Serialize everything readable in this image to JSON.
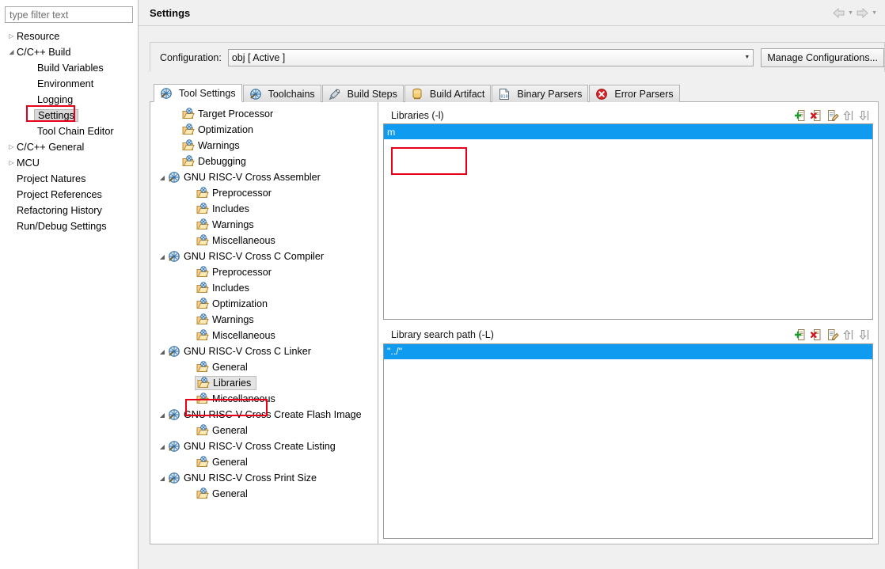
{
  "sidebar": {
    "filter": {
      "placeholder": "type filter text",
      "value": ""
    },
    "items": [
      {
        "label": "Resource",
        "indent": 1,
        "arrow": "collapsed",
        "selected": false
      },
      {
        "label": "C/C++ Build",
        "indent": 1,
        "arrow": "expanded",
        "selected": false
      },
      {
        "label": "Build Variables",
        "indent": 2,
        "arrow": "none",
        "selected": false
      },
      {
        "label": "Environment",
        "indent": 2,
        "arrow": "none",
        "selected": false
      },
      {
        "label": "Logging",
        "indent": 2,
        "arrow": "none",
        "selected": false
      },
      {
        "label": "Settings",
        "indent": 2,
        "arrow": "none",
        "selected": true
      },
      {
        "label": "Tool Chain Editor",
        "indent": 2,
        "arrow": "none",
        "selected": false
      },
      {
        "label": "C/C++ General",
        "indent": 1,
        "arrow": "collapsed",
        "selected": false
      },
      {
        "label": "MCU",
        "indent": 1,
        "arrow": "collapsed",
        "selected": false
      },
      {
        "label": "Project Natures",
        "indent": 1,
        "arrow": "none",
        "selected": false
      },
      {
        "label": "Project References",
        "indent": 1,
        "arrow": "none",
        "selected": false
      },
      {
        "label": "Refactoring History",
        "indent": 1,
        "arrow": "none",
        "selected": false
      },
      {
        "label": "Run/Debug Settings",
        "indent": 1,
        "arrow": "none",
        "selected": false
      }
    ]
  },
  "header": {
    "title": "Settings",
    "back_icon": "back-arrow-icon",
    "forward_icon": "forward-arrow-icon"
  },
  "configuration": {
    "label": "Configuration:",
    "value": "obj  [ Active ]",
    "manage_button": "Manage Configurations..."
  },
  "tabs": [
    {
      "label": "Tool Settings",
      "icon": "tool-settings-icon",
      "active": true
    },
    {
      "label": "Toolchains",
      "icon": "toolchain-icon",
      "active": false
    },
    {
      "label": "Build Steps",
      "icon": "build-steps-icon",
      "active": false
    },
    {
      "label": "Build Artifact",
      "icon": "build-artifact-icon",
      "active": false
    },
    {
      "label": "Binary Parsers",
      "icon": "binary-parsers-icon",
      "active": false
    },
    {
      "label": "Error Parsers",
      "icon": "error-parsers-icon",
      "active": false
    }
  ],
  "tool_tree": [
    {
      "label": "Target Processor",
      "depth": 1,
      "arrow": "none",
      "icon": "option-folder-icon",
      "selected": false
    },
    {
      "label": "Optimization",
      "depth": 1,
      "arrow": "none",
      "icon": "option-folder-icon",
      "selected": false
    },
    {
      "label": "Warnings",
      "depth": 1,
      "arrow": "none",
      "icon": "option-folder-icon",
      "selected": false
    },
    {
      "label": "Debugging",
      "depth": 1,
      "arrow": "none",
      "icon": "option-folder-icon",
      "selected": false
    },
    {
      "label": "GNU RISC-V Cross Assembler",
      "depth": 0,
      "arrow": "expanded",
      "icon": "tool-icon",
      "selected": false
    },
    {
      "label": "Preprocessor",
      "depth": 2,
      "arrow": "none",
      "icon": "option-folder-icon",
      "selected": false
    },
    {
      "label": "Includes",
      "depth": 2,
      "arrow": "none",
      "icon": "option-folder-icon",
      "selected": false
    },
    {
      "label": "Warnings",
      "depth": 2,
      "arrow": "none",
      "icon": "option-folder-icon",
      "selected": false
    },
    {
      "label": "Miscellaneous",
      "depth": 2,
      "arrow": "none",
      "icon": "option-folder-icon",
      "selected": false
    },
    {
      "label": "GNU RISC-V Cross C Compiler",
      "depth": 0,
      "arrow": "expanded",
      "icon": "tool-icon",
      "selected": false
    },
    {
      "label": "Preprocessor",
      "depth": 2,
      "arrow": "none",
      "icon": "option-folder-icon",
      "selected": false
    },
    {
      "label": "Includes",
      "depth": 2,
      "arrow": "none",
      "icon": "option-folder-icon",
      "selected": false
    },
    {
      "label": "Optimization",
      "depth": 2,
      "arrow": "none",
      "icon": "option-folder-icon",
      "selected": false
    },
    {
      "label": "Warnings",
      "depth": 2,
      "arrow": "none",
      "icon": "option-folder-icon",
      "selected": false
    },
    {
      "label": "Miscellaneous",
      "depth": 2,
      "arrow": "none",
      "icon": "option-folder-icon",
      "selected": false
    },
    {
      "label": "GNU RISC-V Cross C Linker",
      "depth": 0,
      "arrow": "expanded",
      "icon": "tool-icon",
      "selected": false
    },
    {
      "label": "General",
      "depth": 2,
      "arrow": "none",
      "icon": "option-folder-icon",
      "selected": false
    },
    {
      "label": "Libraries",
      "depth": 2,
      "arrow": "none",
      "icon": "option-folder-icon",
      "selected": true
    },
    {
      "label": "Miscellaneous",
      "depth": 2,
      "arrow": "none",
      "icon": "option-folder-icon",
      "selected": false
    },
    {
      "label": "GNU RISC-V Cross Create Flash Image",
      "depth": 0,
      "arrow": "expanded",
      "icon": "tool-icon",
      "selected": false
    },
    {
      "label": "General",
      "depth": 2,
      "arrow": "none",
      "icon": "option-folder-icon",
      "selected": false
    },
    {
      "label": "GNU RISC-V Cross Create Listing",
      "depth": 0,
      "arrow": "expanded",
      "icon": "tool-icon",
      "selected": false
    },
    {
      "label": "General",
      "depth": 2,
      "arrow": "none",
      "icon": "option-folder-icon",
      "selected": false
    },
    {
      "label": "GNU RISC-V Cross Print Size",
      "depth": 0,
      "arrow": "expanded",
      "icon": "tool-icon",
      "selected": false
    },
    {
      "label": "General",
      "depth": 2,
      "arrow": "none",
      "icon": "option-folder-icon",
      "selected": false
    }
  ],
  "option_panels": [
    {
      "title": "Libraries (-l)",
      "tools": [
        "add-icon",
        "delete-icon",
        "edit-icon",
        "move-up-icon",
        "move-down-icon"
      ],
      "entries": [
        {
          "value": "m",
          "selected": true
        }
      ]
    },
    {
      "title": "Library search path (-L)",
      "tools": [
        "add-icon",
        "delete-icon",
        "edit-icon",
        "move-up-icon",
        "move-down-icon"
      ],
      "entries": [
        {
          "value": "\"../\"",
          "selected": true
        }
      ]
    }
  ],
  "colors": {
    "selection_blue": "#0f9bf0",
    "annotation_red": "#e8001a",
    "panel_gray": "#f0f0f0",
    "tree_selection_gray": "#d9d9d9"
  }
}
